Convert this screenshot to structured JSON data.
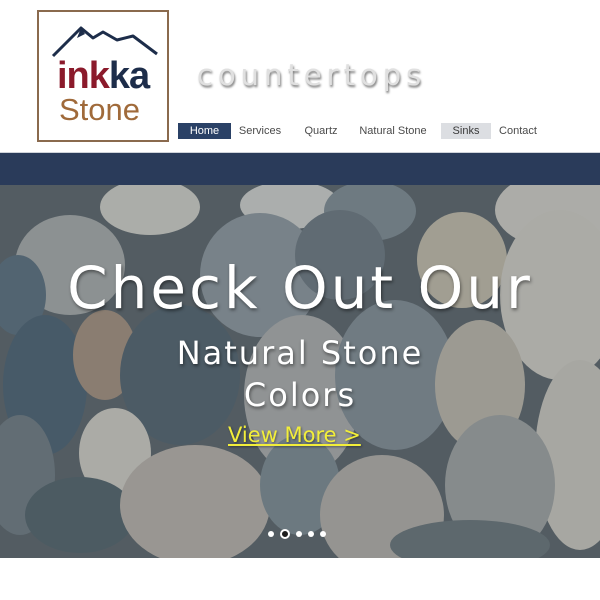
{
  "logo": {
    "brand_ink": "ink",
    "brand_ka": "ka",
    "stone": "Stone"
  },
  "tagline": "countertops",
  "nav": {
    "items": [
      {
        "label": "Home",
        "state": "active"
      },
      {
        "label": "Services",
        "state": "normal"
      },
      {
        "label": "Quartz",
        "state": "normal"
      },
      {
        "label": "Natural Stone",
        "state": "normal"
      },
      {
        "label": "Sinks",
        "state": "hover"
      },
      {
        "label": "Contact",
        "state": "normal"
      }
    ]
  },
  "hero": {
    "title": "Check Out Our",
    "subtitle_line1": "Natural Stone",
    "subtitle_line2": "Colors",
    "link": "View More >",
    "slides_total": 5,
    "slide_current": 2
  },
  "colors": {
    "navy": "#2a3b5a",
    "brand_red": "#8b1a2b",
    "brand_brown": "#a06a3a",
    "link_yellow": "#f2ee3a"
  }
}
